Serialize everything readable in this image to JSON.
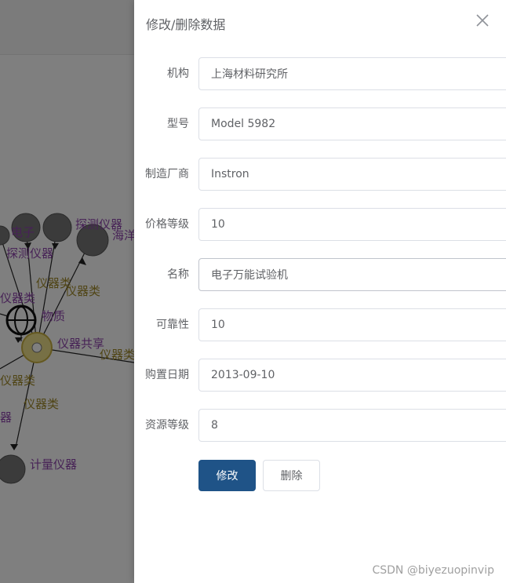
{
  "drawer": {
    "title": "修改/删除数据",
    "close_icon": "close-icon"
  },
  "form": {
    "fields": [
      {
        "label": "机构",
        "value": "上海材料研究所"
      },
      {
        "label": "型号",
        "value": "Model 5982"
      },
      {
        "label": "制造厂商",
        "value": "Instron"
      },
      {
        "label": "价格等级",
        "value": "10"
      },
      {
        "label": "名称",
        "value": "电子万能试验机"
      },
      {
        "label": "可靠性",
        "value": "10"
      },
      {
        "label": "购置日期",
        "value": "2013-09-10"
      },
      {
        "label": "资源等级",
        "value": "8"
      }
    ],
    "modify_label": "修改",
    "delete_label": "删除"
  },
  "graph": {
    "labels": [
      "电子",
      "探测仪器",
      "探测仪器",
      "海洋",
      "仪器类",
      "仪器类",
      "仪器类",
      "物质",
      "仪器共享",
      "仪器类",
      "仪器类",
      "仪器类",
      "计量仪器",
      "器"
    ]
  },
  "watermark": "CSDN @biyezuopinvip",
  "colors": {
    "primary": "#1f5387",
    "node_label": "#8e44ad",
    "node_label_alt": "#a08a2a"
  }
}
